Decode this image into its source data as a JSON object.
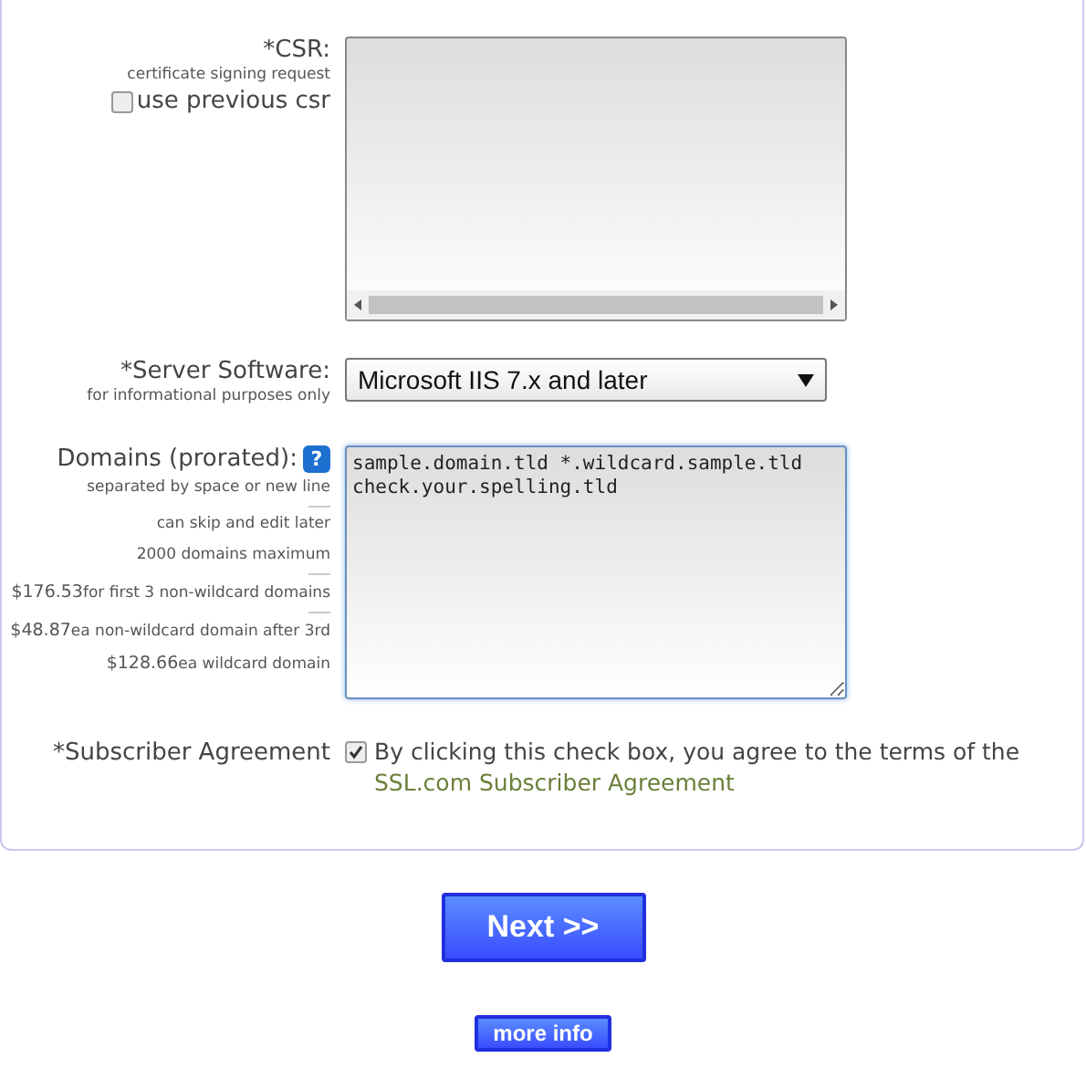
{
  "csr": {
    "label": "*CSR:",
    "hint": "certificate signing request",
    "use_previous": {
      "label": "use previous csr",
      "checked": false
    }
  },
  "server_software": {
    "label": "*Server Software:",
    "hint": "for informational purposes only",
    "value": "Microsoft IIS 7.x and later"
  },
  "domains": {
    "label": "Domains (prorated):",
    "help": "?",
    "value": "sample.domain.tld *.wildcard.sample.tld\ncheck.your.spelling.tld",
    "notes": [
      {
        "text": "separated by space or new line"
      },
      {
        "text": "can skip and edit later"
      },
      {
        "text": "2000 domains maximum"
      },
      {
        "price": "$176.53",
        "text": "for first 3 non-wildcard domains"
      },
      {
        "price": "$48.87",
        "text": "ea non-wildcard domain after 3rd"
      },
      {
        "price": "$128.66",
        "text": "ea wildcard domain"
      }
    ]
  },
  "agreement": {
    "label": "*Subscriber Agreement",
    "checked": true,
    "text": "By clicking this check box, you agree to the terms of the",
    "link": "SSL.com Subscriber Agreement"
  },
  "buttons": {
    "next": "Next >>",
    "more_info": "more info"
  }
}
